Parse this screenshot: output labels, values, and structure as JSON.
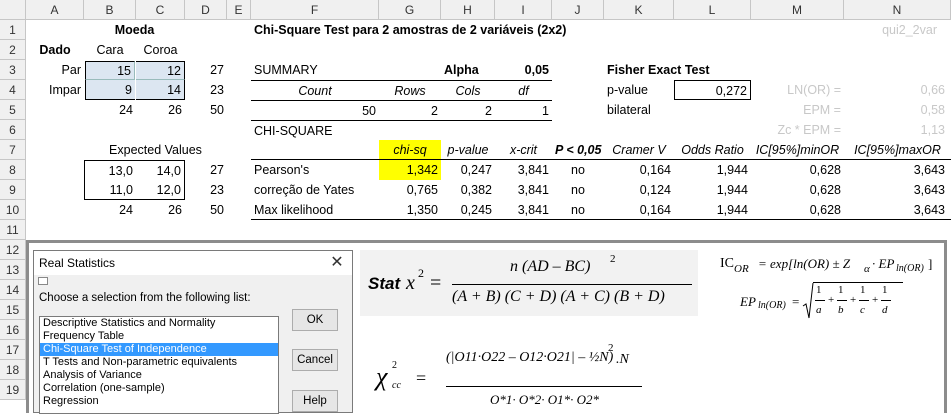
{
  "columns": [
    "A",
    "B",
    "C",
    "D",
    "E",
    "F",
    "G",
    "H",
    "I",
    "J",
    "K",
    "L",
    "M",
    "N"
  ],
  "rows": [
    "1",
    "2",
    "3",
    "4",
    "5",
    "6",
    "7",
    "8",
    "9",
    "10",
    "11",
    "12",
    "13",
    "14",
    "15",
    "16",
    "17",
    "18",
    "19"
  ],
  "cells": {
    "moeda": "Moeda",
    "dado": "Dado",
    "cara": "Cara",
    "coroa": "Coroa",
    "par": "Par",
    "impar": "Impar",
    "b3": "15",
    "c3": "12",
    "d3": "27",
    "b4": "9",
    "c4": "14",
    "d4": "23",
    "b5": "24",
    "c5": "26",
    "d5": "50",
    "expected_values": "Expected Values",
    "b8": "13,0",
    "c8": "14,0",
    "d8": "27",
    "b9": "11,0",
    "c9": "12,0",
    "d9": "23",
    "b10": "24",
    "c10": "26",
    "d10": "50",
    "title": "Chi-Square Test para 2 amostras de 2 variáveis (2x2)",
    "n1": "qui2_2var",
    "summary": "SUMMARY",
    "alpha_label": "Alpha",
    "alpha_value": "0,05",
    "fisher": "Fisher Exact Test",
    "count": "Count",
    "rows_lbl": "Rows",
    "cols_lbl": "Cols",
    "df": "df",
    "pvalue_label": "p-value",
    "pvalue_value": "0,272",
    "lnor_lbl": "LN(OR) =",
    "lnor_val": "0,66",
    "f5": "50",
    "g5": "2",
    "h5": "2",
    "i5": "1",
    "bilateral": "bilateral",
    "epm_lbl": "EPM =",
    "epm_val": "0,58",
    "chisquare": "CHI-SQUARE",
    "zc_lbl": "Zc * EPM =",
    "zc_val": "1,13",
    "h_chisq": "chi-sq",
    "h_pvalue": "p-value",
    "h_xcrit": "x-crit",
    "h_p005": "P < 0,05",
    "h_cramer": "Cramer V",
    "h_odds": "Odds Ratio",
    "h_icmin": "IC[95%]minOR",
    "h_icmax": "IC[95%]maxOR",
    "table": [
      {
        "name": "Pearson's",
        "chisq": "1,342",
        "p": "0,247",
        "x": "3,841",
        "sig": "no",
        "v": "0,164",
        "or": "1,944",
        "min": "0,628",
        "max": "3,643"
      },
      {
        "name": "correção de Yates",
        "chisq": "0,765",
        "p": "0,382",
        "x": "3,841",
        "sig": "no",
        "v": "0,124",
        "or": "1,944",
        "min": "0,628",
        "max": "3,643"
      },
      {
        "name": "Max likelihood",
        "chisq": "1,350",
        "p": "0,245",
        "x": "3,841",
        "sig": "no",
        "v": "0,164",
        "or": "1,944",
        "min": "0,628",
        "max": "3,643"
      }
    ]
  },
  "dialog": {
    "title": "Real Statistics",
    "prompt": "Choose a selection from the following list:",
    "items": [
      "Descriptive Statistics and Normality",
      "Frequency Table",
      "Chi-Square Test of Independence",
      "T Tests and Non-parametric equivalents",
      "Analysis of Variance",
      "Correlation (one-sample)",
      "Regression"
    ],
    "selected_index": 2,
    "ok": "OK",
    "cancel": "Cancel",
    "help": "Help",
    "close_icon": "close-icon"
  },
  "formulas": {
    "stat": "Stat",
    "x2": "x",
    "sup2": "2",
    "eq": "=",
    "numerator": "n (AD – BC)",
    "denominator": "(A + B) (C + D) (A + C) (B + D)",
    "ic_left": "IC",
    "ic_sub": "OR",
    "ic_right": "= exp[ln(OR) ± Z",
    "ic_alpha": "α",
    "ic_ep": "· EP",
    "ic_ln": "ln(OR)",
    "ic_close": "]",
    "ep_left": "EP",
    "ep_sub": "ln(OR)",
    "ep_eq": "=",
    "fr_1": "1",
    "fr_a": "a",
    "fr_b": "b",
    "fr_c": "c",
    "fr_d": "d",
    "plus": "+",
    "chi": "χ",
    "cc": "cc",
    "yates_num": "(|O11·O22 – O12·O21| – ½N)",
    "yates_n": ".N",
    "yates_den": "O*1· O*2· O1*· O2*"
  }
}
